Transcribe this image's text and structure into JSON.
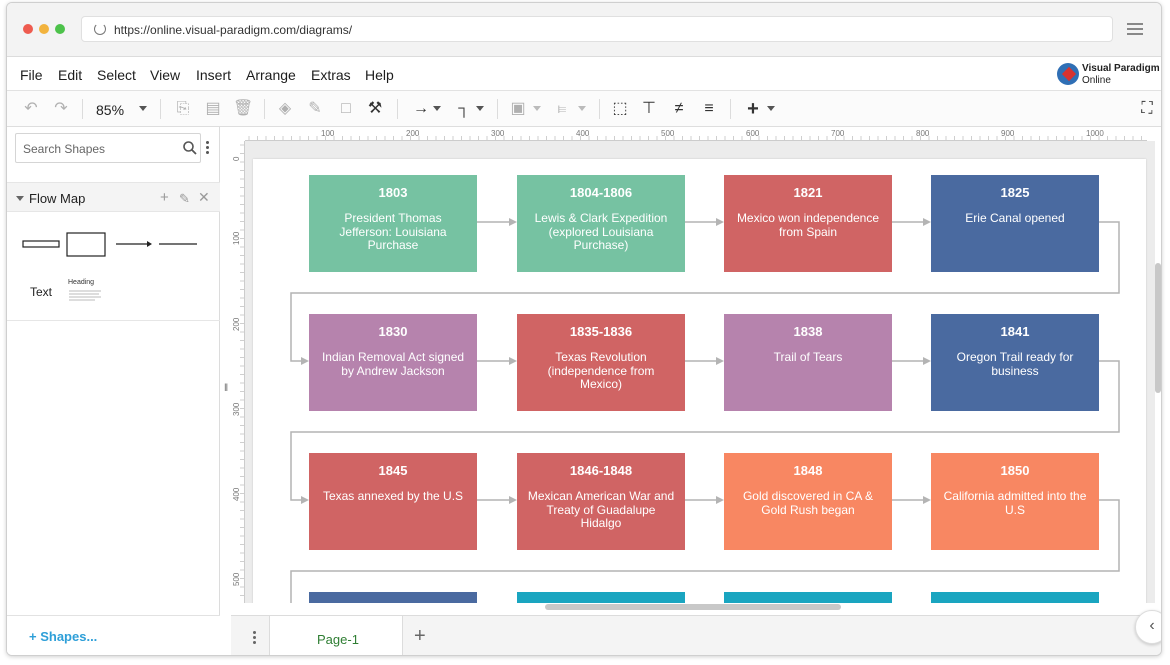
{
  "browser": {
    "url": "https://online.visual-paradigm.com/diagrams/",
    "dot_colors": [
      "#ee5b4f",
      "#f2b33d",
      "#4cc24a"
    ]
  },
  "menu": {
    "items": [
      "File",
      "Edit",
      "Select",
      "View",
      "Insert",
      "Arrange",
      "Extras",
      "Help"
    ],
    "logo_line1": "Visual Paradigm",
    "logo_line2": "Online"
  },
  "toolbar": {
    "zoom": "85%",
    "icons": [
      "undo-icon",
      "redo-icon",
      "zoom-dropdown",
      "copy-icon",
      "paste-icon",
      "delete-icon",
      "fill-color-icon",
      "line-color-icon",
      "shadow-icon",
      "format-painter-icon",
      "connector-style-icon",
      "waypoint-icon",
      "to-front-icon",
      "align-icon",
      "fit-page-icon",
      "distribute-h-icon",
      "align-center-icon",
      "align-left-icon",
      "insert-plus-icon",
      "fullscreen-icon"
    ]
  },
  "sidebar": {
    "search_placeholder": "Search Shapes",
    "library_title": "Flow Map",
    "shape_text_label": "Text",
    "shape_heading_label": "Heading",
    "more_shapes": "Shapes..."
  },
  "rulers": {
    "h_ticks": [
      "100",
      "200",
      "300",
      "400",
      "500",
      "600",
      "700",
      "800",
      "900",
      "1000"
    ],
    "v_ticks": [
      "0",
      "100",
      "200",
      "300",
      "400",
      "500"
    ]
  },
  "diagram": {
    "colors": {
      "green": "#76c2a2",
      "red": "#d06464",
      "blue": "#4a6aa0",
      "purple": "#b683ad",
      "orange": "#f88762",
      "teal": "#1aa5c0"
    },
    "rows": [
      [
        {
          "year": "1803",
          "desc": "President Thomas Jefferson: Louisiana Purchase",
          "color": "#76c2a2"
        },
        {
          "year": "1804-1806",
          "desc": "Lewis & Clark Expedition (explored Louisiana Purchase)",
          "color": "#76c2a2"
        },
        {
          "year": "1821",
          "desc": "Mexico won independence from Spain",
          "color": "#d06464"
        },
        {
          "year": "1825",
          "desc": "Erie Canal opened",
          "color": "#4a6aa0"
        }
      ],
      [
        {
          "year": "1830",
          "desc": "Indian Removal Act signed by Andrew Jackson",
          "color": "#b683ad"
        },
        {
          "year": "1835-1836",
          "desc": "Texas Revolution (independence from Mexico)",
          "color": "#d06464"
        },
        {
          "year": "1838",
          "desc": "Trail of Tears",
          "color": "#b683ad"
        },
        {
          "year": "1841",
          "desc": "Oregon Trail ready for business",
          "color": "#4a6aa0"
        }
      ],
      [
        {
          "year": "1845",
          "desc": "Texas annexed by the U.S",
          "color": "#d06464"
        },
        {
          "year": "1846-1848",
          "desc": "Mexican American War and Treaty of Guadalupe Hidalgo",
          "color": "#d06464"
        },
        {
          "year": "1848",
          "desc": "Gold discovered in CA & Gold Rush began",
          "color": "#f88762"
        },
        {
          "year": "1850",
          "desc": "California admitted into the U.S",
          "color": "#f88762"
        }
      ],
      [
        {
          "year": "",
          "desc": "",
          "color": "#4a6aa0"
        },
        {
          "year": "",
          "desc": "",
          "color": "#1aa5c0"
        },
        {
          "year": "",
          "desc": "",
          "color": "#1aa5c0"
        },
        {
          "year": "",
          "desc": "",
          "color": "#1aa5c0"
        }
      ]
    ]
  },
  "tabs": {
    "page_label": "Page-1"
  }
}
